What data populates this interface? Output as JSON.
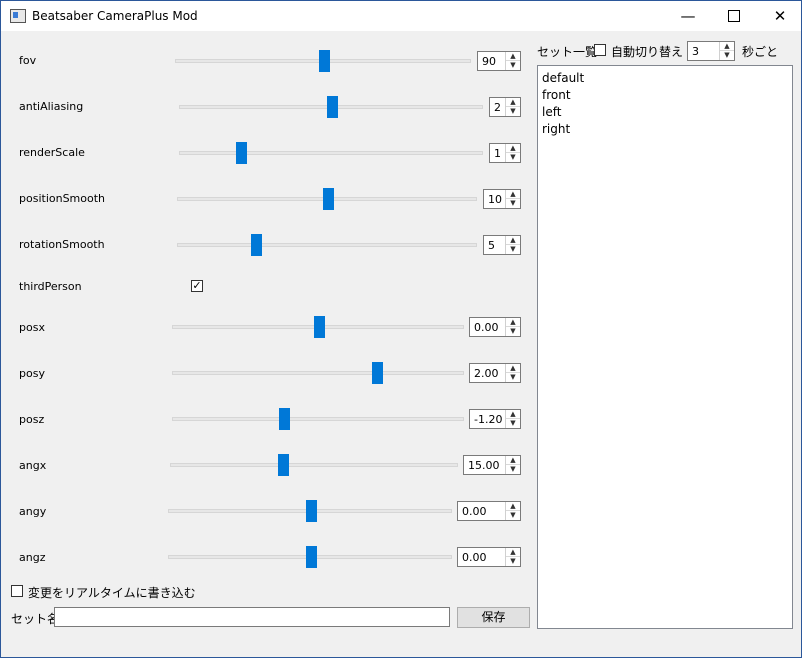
{
  "window": {
    "title": "Beatsaber CameraPlus Mod",
    "accent": "#0078d7"
  },
  "controls": {
    "fov": {
      "label": "fov",
      "value": "90",
      "level": 0.5
    },
    "antiAliasing": {
      "label": "antiAliasing",
      "value": "2",
      "level": 0.5
    },
    "renderScale": {
      "label": "renderScale",
      "value": "1",
      "level": 0.2
    },
    "positionSmooth": {
      "label": "positionSmooth",
      "value": "10",
      "level": 0.5
    },
    "rotationSmooth": {
      "label": "rotationSmooth",
      "value": "5",
      "level": 0.26
    },
    "thirdPerson": {
      "label": "thirdPerson",
      "checked": true,
      "mark": "✓"
    },
    "posx": {
      "label": "posx",
      "value": "0.00",
      "level": 0.5
    },
    "posy": {
      "label": "posy",
      "value": "2.00",
      "level": 0.7
    },
    "posz": {
      "label": "posz",
      "value": "-1.20",
      "level": 0.38
    },
    "angx": {
      "label": "angx",
      "value": "15.00",
      "level": 0.39
    },
    "angy": {
      "label": "angy",
      "value": "0.00",
      "level": 0.5
    },
    "angz": {
      "label": "angz",
      "value": "0.00",
      "level": 0.5
    }
  },
  "realtime": {
    "label": "変更をリアルタイムに書き込む",
    "checked": false
  },
  "setname": {
    "label": "セット名",
    "value": ""
  },
  "save_label": "保存",
  "setlist": {
    "label": "セット一覧",
    "auto_label": "自動切り替え",
    "auto_checked": false,
    "interval": "3",
    "interval_unit": "秒ごと",
    "items": [
      "default",
      "front",
      "left",
      "right"
    ]
  }
}
